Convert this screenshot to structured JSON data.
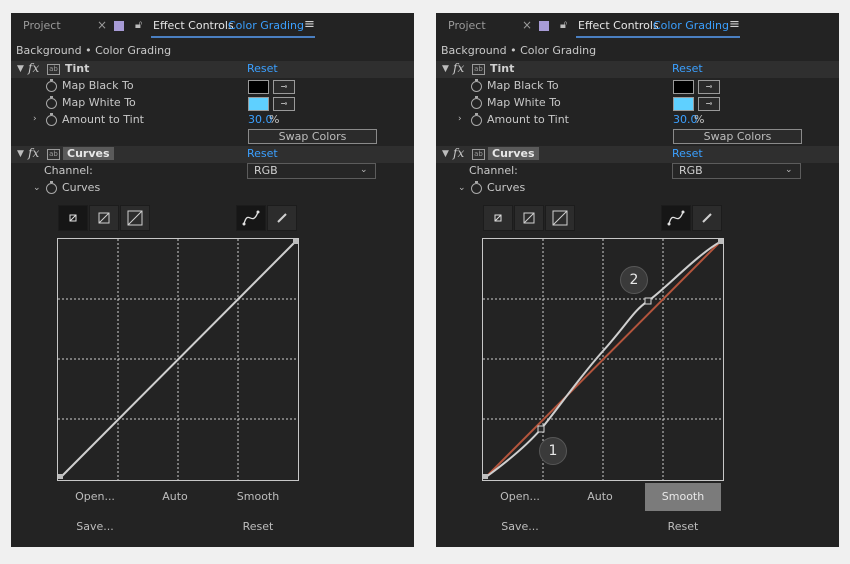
{
  "tabs": {
    "project": "Project",
    "close_glyph": "×",
    "effect_controls": "Effect Controls",
    "composition": "Color Grading",
    "menu_glyph": "≡"
  },
  "breadcrumb": "Background • Color Grading",
  "tint": {
    "name": "Tint",
    "reset": "Reset",
    "map_black_label": "Map Black To",
    "map_white_label": "Map White To",
    "amount_label": "Amount to Tint",
    "amount_value": "30.0",
    "amount_unit": "%",
    "swap_label": "Swap Colors",
    "black_color": "#000000",
    "white_color": "#5fd0ff"
  },
  "curves": {
    "name": "Curves",
    "reset": "Reset",
    "channel_label": "Channel:",
    "channel_value": "RGB",
    "curves_label": "Curves",
    "buttons": {
      "open": "Open...",
      "auto": "Auto",
      "smooth": "Smooth",
      "save": "Save...",
      "reset": "Reset"
    }
  },
  "panels": [
    {
      "callouts": []
    },
    {
      "callouts": [
        "1",
        "2"
      ]
    }
  ],
  "colors": {
    "accent_blue": "#3ba0ff",
    "panel_bg": "#232323",
    "curve": "#cfcfcf",
    "reference_line": "#b4553d",
    "smooth_active": "#7b7b7b"
  }
}
